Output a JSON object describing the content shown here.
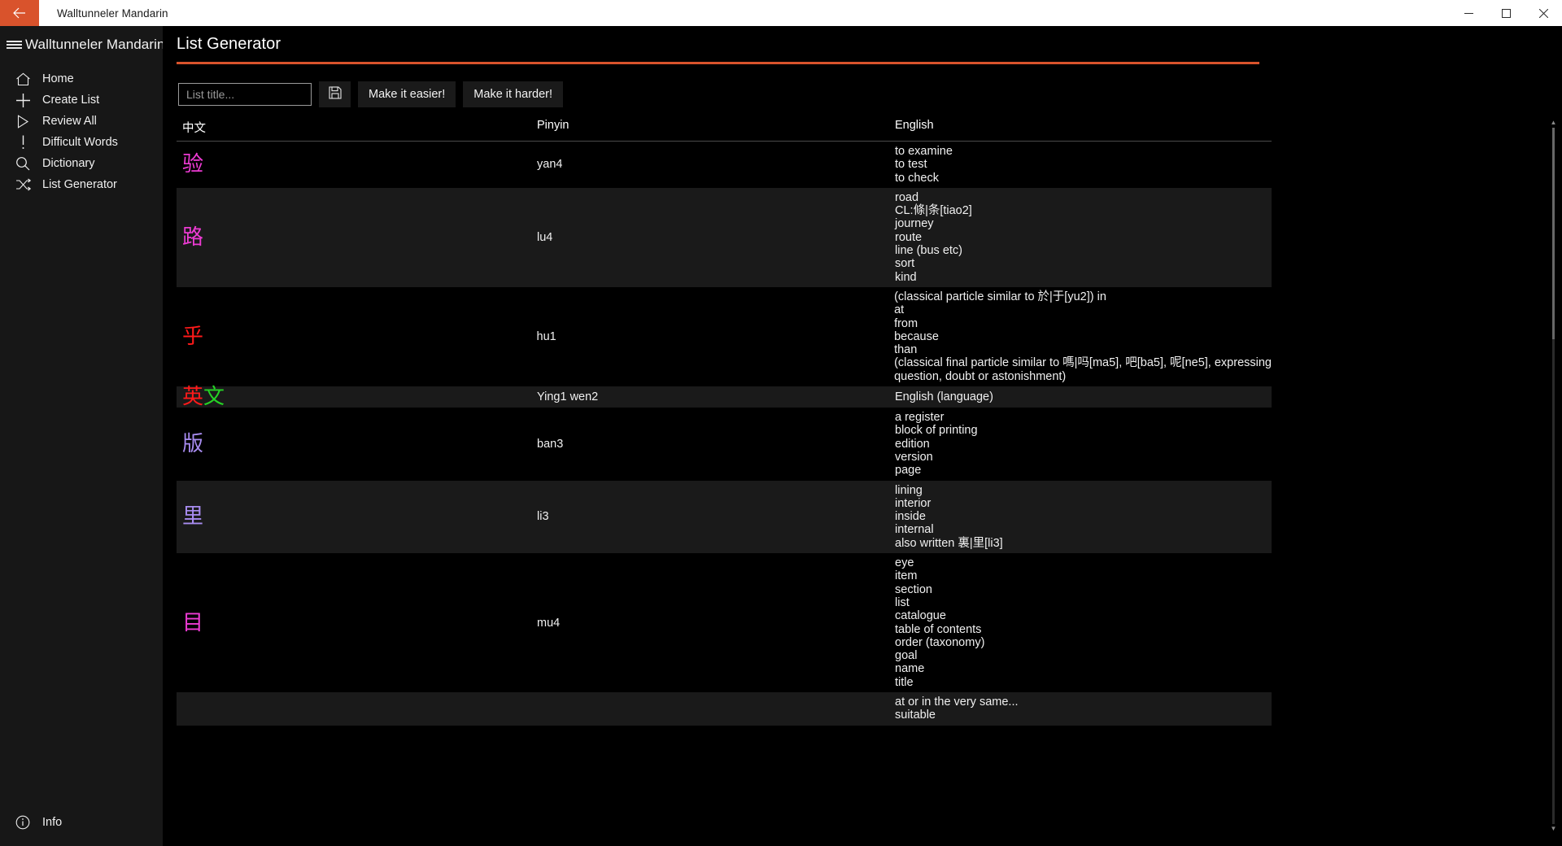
{
  "window": {
    "title": "Walltunneler Mandarin",
    "back_icon": "back-arrow-icon",
    "minimize_label": "Minimize",
    "maximize_label": "Maximize",
    "close_label": "Close",
    "accent_color": "#d9532c"
  },
  "sidebar": {
    "menu_icon": "hamburger-icon",
    "app_name": "Walltunneler Mandarin",
    "items": [
      {
        "label": "Home",
        "icon": "home-icon"
      },
      {
        "label": "Create List",
        "icon": "plus-icon"
      },
      {
        "label": "Review All",
        "icon": "play-icon"
      },
      {
        "label": "Difficult Words",
        "icon": "exclamation-icon"
      },
      {
        "label": "Dictionary",
        "icon": "search-icon"
      },
      {
        "label": "List Generator",
        "icon": "shuffle-icon"
      }
    ],
    "bottom": {
      "label": "Info",
      "icon": "info-icon"
    }
  },
  "main": {
    "page_title": "List Generator",
    "toolbar": {
      "title_placeholder": "List title...",
      "title_value": "",
      "save_icon": "save-floppy-icon",
      "easier_label": "Make it easier!",
      "harder_label": "Make it harder!"
    },
    "table": {
      "columns": [
        "中文",
        "Pinyin",
        "English"
      ],
      "rows": [
        {
          "hanzi": [
            {
              "char": "验",
              "color": "#ee3bd4"
            }
          ],
          "pinyin": "yan4",
          "english": [
            "to examine",
            "to test",
            "to check"
          ]
        },
        {
          "hanzi": [
            {
              "char": "路",
              "color": "#ee3bd4"
            }
          ],
          "pinyin": "lu4",
          "english": [
            "road",
            "CL:條|条[tiao2]",
            "journey",
            "route",
            "line (bus etc)",
            "sort",
            "kind"
          ]
        },
        {
          "hanzi": [
            {
              "char": "乎",
              "color": "#ff1a1a"
            }
          ],
          "pinyin": "hu1",
          "english": [
            "(classical particle similar to 於|于[yu2]) in",
            "at",
            "from",
            "because",
            "than",
            "(classical final particle similar to 嗎|吗[ma5], 吧[ba5], 呢[ne5], expressing",
            "question, doubt or astonishment)"
          ]
        },
        {
          "hanzi": [
            {
              "char": "英",
              "color": "#ff1a1a"
            },
            {
              "char": "文",
              "color": "#25d425"
            }
          ],
          "pinyin": "Ying1 wen2",
          "english": [
            "English (language)"
          ]
        },
        {
          "hanzi": [
            {
              "char": "版",
              "color": "#a88cf0"
            }
          ],
          "pinyin": "ban3",
          "english": [
            "a register",
            "block of printing",
            "edition",
            "version",
            "page"
          ]
        },
        {
          "hanzi": [
            {
              "char": "里",
              "color": "#a88cf0"
            }
          ],
          "pinyin": "li3",
          "english": [
            "lining",
            "interior",
            "inside",
            "internal",
            "also written 裏|里[li3]"
          ]
        },
        {
          "hanzi": [
            {
              "char": "目",
              "color": "#ee3bd4"
            }
          ],
          "pinyin": "mu4",
          "english": [
            "eye",
            "item",
            "section",
            "list",
            "catalogue",
            "table of contents",
            "order (taxonomy)",
            "goal",
            "name",
            "title"
          ]
        },
        {
          "hanzi": [],
          "pinyin": "",
          "english": [
            "at or in the very same...",
            "suitable"
          ]
        }
      ]
    },
    "scrollbar": {
      "up_glyph": "▲",
      "down_glyph": "▼",
      "name": "vertical-scrollbar"
    }
  }
}
